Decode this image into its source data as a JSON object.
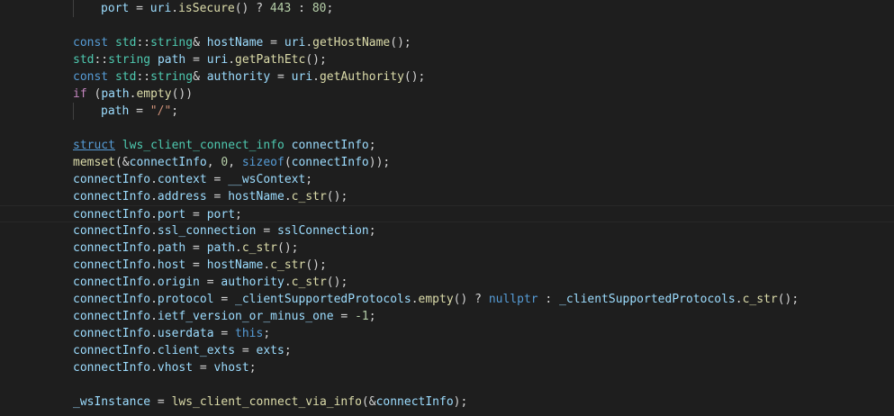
{
  "editor": {
    "theme": "dark",
    "background": "#1e1e1e",
    "current_line_index": 12,
    "lines": [
      {
        "indent": 1,
        "tokens": [
          [
            "port",
            "cyan"
          ],
          [
            " = ",
            "plain"
          ],
          [
            "uri",
            "cyan"
          ],
          [
            ".",
            "plain"
          ],
          [
            "isSecure",
            "fn"
          ],
          [
            "() ? ",
            "plain"
          ],
          [
            "443",
            "num"
          ],
          [
            " : ",
            "plain"
          ],
          [
            "80",
            "num"
          ],
          [
            ";",
            "plain"
          ]
        ]
      },
      {
        "indent": 0,
        "tokens": []
      },
      {
        "indent": 0,
        "tokens": [
          [
            "const",
            "blue"
          ],
          [
            " ",
            "plain"
          ],
          [
            "std",
            "type"
          ],
          [
            "::",
            "plain"
          ],
          [
            "string",
            "type"
          ],
          [
            "& ",
            "plain"
          ],
          [
            "hostName",
            "cyan"
          ],
          [
            " = ",
            "plain"
          ],
          [
            "uri",
            "cyan"
          ],
          [
            ".",
            "plain"
          ],
          [
            "getHostName",
            "fn"
          ],
          [
            "();",
            "plain"
          ]
        ]
      },
      {
        "indent": 0,
        "tokens": [
          [
            "std",
            "type"
          ],
          [
            "::",
            "plain"
          ],
          [
            "string",
            "type"
          ],
          [
            " ",
            "plain"
          ],
          [
            "path",
            "cyan"
          ],
          [
            " = ",
            "plain"
          ],
          [
            "uri",
            "cyan"
          ],
          [
            ".",
            "plain"
          ],
          [
            "getPathEtc",
            "fn"
          ],
          [
            "();",
            "plain"
          ]
        ]
      },
      {
        "indent": 0,
        "tokens": [
          [
            "const",
            "blue"
          ],
          [
            " ",
            "plain"
          ],
          [
            "std",
            "type"
          ],
          [
            "::",
            "plain"
          ],
          [
            "string",
            "type"
          ],
          [
            "& ",
            "plain"
          ],
          [
            "authority",
            "cyan"
          ],
          [
            " = ",
            "plain"
          ],
          [
            "uri",
            "cyan"
          ],
          [
            ".",
            "plain"
          ],
          [
            "getAuthority",
            "fn"
          ],
          [
            "();",
            "plain"
          ]
        ]
      },
      {
        "indent": 0,
        "tokens": [
          [
            "if",
            "kw"
          ],
          [
            " (",
            "plain"
          ],
          [
            "path",
            "cyan"
          ],
          [
            ".",
            "plain"
          ],
          [
            "empty",
            "fn"
          ],
          [
            "())",
            "plain"
          ]
        ]
      },
      {
        "indent": 1,
        "tokens": [
          [
            "path",
            "cyan"
          ],
          [
            " = ",
            "plain"
          ],
          [
            "\"/\"",
            "str"
          ],
          [
            ";",
            "plain"
          ]
        ]
      },
      {
        "indent": 0,
        "tokens": []
      },
      {
        "indent": 0,
        "tokens": [
          [
            "struct",
            "blue-ul"
          ],
          [
            " ",
            "plain"
          ],
          [
            "lws_client_connect_info",
            "type"
          ],
          [
            " ",
            "plain"
          ],
          [
            "connectInfo",
            "cyan"
          ],
          [
            ";",
            "plain"
          ]
        ]
      },
      {
        "indent": 0,
        "tokens": [
          [
            "memset",
            "fn"
          ],
          [
            "(&",
            "plain"
          ],
          [
            "connectInfo",
            "cyan"
          ],
          [
            ", ",
            "plain"
          ],
          [
            "0",
            "num"
          ],
          [
            ", ",
            "plain"
          ],
          [
            "sizeof",
            "blue"
          ],
          [
            "(",
            "plain"
          ],
          [
            "connectInfo",
            "cyan"
          ],
          [
            "));",
            "plain"
          ]
        ]
      },
      {
        "indent": 0,
        "tokens": [
          [
            "connectInfo",
            "cyan"
          ],
          [
            ".",
            "plain"
          ],
          [
            "context",
            "cyan"
          ],
          [
            " = ",
            "plain"
          ],
          [
            "__wsContext",
            "cyan"
          ],
          [
            ";",
            "plain"
          ]
        ]
      },
      {
        "indent": 0,
        "tokens": [
          [
            "connectInfo",
            "cyan"
          ],
          [
            ".",
            "plain"
          ],
          [
            "address",
            "cyan"
          ],
          [
            " = ",
            "plain"
          ],
          [
            "hostName",
            "cyan"
          ],
          [
            ".",
            "plain"
          ],
          [
            "c_str",
            "fn"
          ],
          [
            "();",
            "plain"
          ]
        ]
      },
      {
        "indent": 0,
        "tokens": [
          [
            "connectInfo",
            "cyan"
          ],
          [
            ".",
            "plain"
          ],
          [
            "port",
            "cyan"
          ],
          [
            " = ",
            "plain"
          ],
          [
            "port",
            "cyan"
          ],
          [
            ";",
            "plain"
          ]
        ]
      },
      {
        "indent": 0,
        "tokens": [
          [
            "connectInfo",
            "cyan"
          ],
          [
            ".",
            "plain"
          ],
          [
            "ssl_connection",
            "cyan"
          ],
          [
            " = ",
            "plain"
          ],
          [
            "sslConnection",
            "cyan"
          ],
          [
            ";",
            "plain"
          ]
        ]
      },
      {
        "indent": 0,
        "tokens": [
          [
            "connectInfo",
            "cyan"
          ],
          [
            ".",
            "plain"
          ],
          [
            "path",
            "cyan"
          ],
          [
            " = ",
            "plain"
          ],
          [
            "path",
            "cyan"
          ],
          [
            ".",
            "plain"
          ],
          [
            "c_str",
            "fn"
          ],
          [
            "();",
            "plain"
          ]
        ]
      },
      {
        "indent": 0,
        "tokens": [
          [
            "connectInfo",
            "cyan"
          ],
          [
            ".",
            "plain"
          ],
          [
            "host",
            "cyan"
          ],
          [
            " = ",
            "plain"
          ],
          [
            "hostName",
            "cyan"
          ],
          [
            ".",
            "plain"
          ],
          [
            "c_str",
            "fn"
          ],
          [
            "();",
            "plain"
          ]
        ]
      },
      {
        "indent": 0,
        "tokens": [
          [
            "connectInfo",
            "cyan"
          ],
          [
            ".",
            "plain"
          ],
          [
            "origin",
            "cyan"
          ],
          [
            " = ",
            "plain"
          ],
          [
            "authority",
            "cyan"
          ],
          [
            ".",
            "plain"
          ],
          [
            "c_str",
            "fn"
          ],
          [
            "();",
            "plain"
          ]
        ]
      },
      {
        "indent": 0,
        "tokens": [
          [
            "connectInfo",
            "cyan"
          ],
          [
            ".",
            "plain"
          ],
          [
            "protocol",
            "cyan"
          ],
          [
            " = ",
            "plain"
          ],
          [
            "_clientSupportedProtocols",
            "cyan"
          ],
          [
            ".",
            "plain"
          ],
          [
            "empty",
            "fn"
          ],
          [
            "() ? ",
            "plain"
          ],
          [
            "nullptr",
            "blue"
          ],
          [
            " : ",
            "plain"
          ],
          [
            "_clientSupportedProtocols",
            "cyan"
          ],
          [
            ".",
            "plain"
          ],
          [
            "c_str",
            "fn"
          ],
          [
            "();",
            "plain"
          ]
        ]
      },
      {
        "indent": 0,
        "tokens": [
          [
            "connectInfo",
            "cyan"
          ],
          [
            ".",
            "plain"
          ],
          [
            "ietf_version_or_minus_one",
            "cyan"
          ],
          [
            " = ",
            "plain"
          ],
          [
            "-1",
            "num"
          ],
          [
            ";",
            "plain"
          ]
        ]
      },
      {
        "indent": 0,
        "tokens": [
          [
            "connectInfo",
            "cyan"
          ],
          [
            ".",
            "plain"
          ],
          [
            "userdata",
            "cyan"
          ],
          [
            " = ",
            "plain"
          ],
          [
            "this",
            "blue"
          ],
          [
            ";",
            "plain"
          ]
        ]
      },
      {
        "indent": 0,
        "tokens": [
          [
            "connectInfo",
            "cyan"
          ],
          [
            ".",
            "plain"
          ],
          [
            "client_exts",
            "cyan"
          ],
          [
            " = ",
            "plain"
          ],
          [
            "exts",
            "cyan"
          ],
          [
            ";",
            "plain"
          ]
        ]
      },
      {
        "indent": 0,
        "tokens": [
          [
            "connectInfo",
            "cyan"
          ],
          [
            ".",
            "plain"
          ],
          [
            "vhost",
            "cyan"
          ],
          [
            " = ",
            "plain"
          ],
          [
            "vhost",
            "cyan"
          ],
          [
            ";",
            "plain"
          ]
        ]
      },
      {
        "indent": 0,
        "tokens": []
      },
      {
        "indent": 0,
        "tokens": [
          [
            "_wsInstance",
            "cyan"
          ],
          [
            " = ",
            "plain"
          ],
          [
            "lws_client_connect_via_info",
            "fn"
          ],
          [
            "(&",
            "plain"
          ],
          [
            "connectInfo",
            "cyan"
          ],
          [
            ");",
            "plain"
          ]
        ]
      }
    ]
  }
}
